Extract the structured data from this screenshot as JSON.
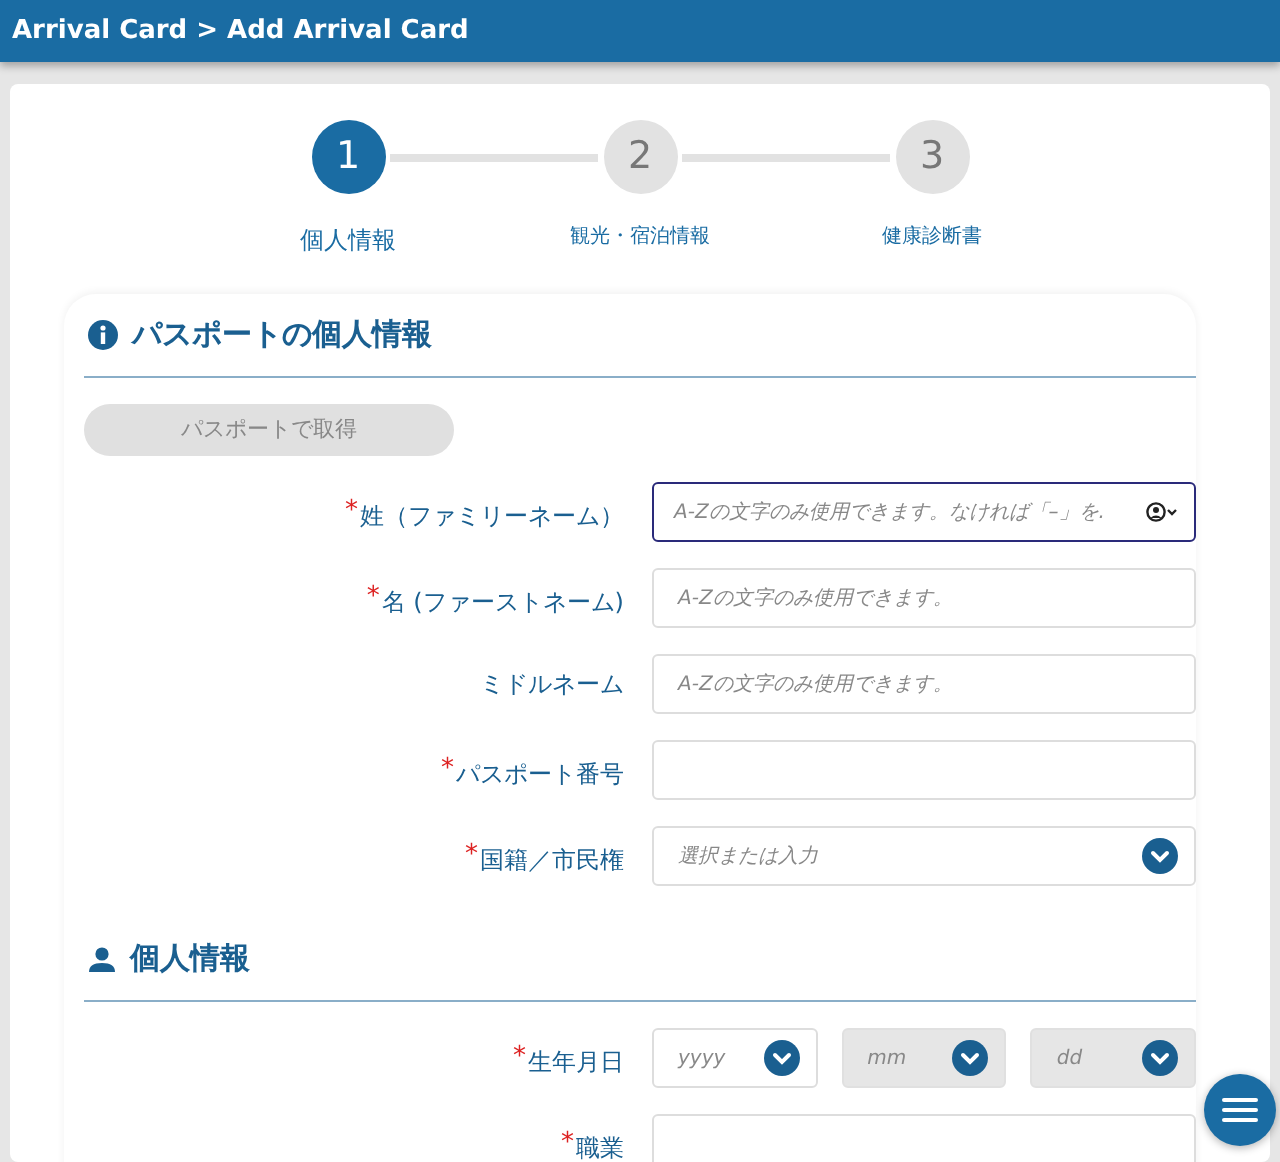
{
  "header": {
    "breadcrumb": "Arrival Card > Add Arrival Card"
  },
  "required_marker": "*",
  "steps": [
    {
      "number": "1",
      "label": "個人情報",
      "selected": true
    },
    {
      "number": "2",
      "label": "観光・宿泊情報",
      "selected": false
    },
    {
      "number": "3",
      "label": "健康診断書",
      "selected": false
    }
  ],
  "sections": [
    {
      "kind": "info",
      "title": "パスポートの個人情報",
      "button": {
        "label": "パスポートで取得",
        "disabled": true
      },
      "fields": [
        {
          "kind": "text",
          "label": "姓（ファミリーネーム）",
          "required": true,
          "placeholder": "A-Zの文字のみ使用できます。なければ「–」を.",
          "focused": true,
          "autofill": true
        },
        {
          "kind": "text",
          "label": "名 (ファーストネーム)",
          "required": true,
          "placeholder": "A-Zの文字のみ使用できます。",
          "focused": false,
          "autofill": false
        },
        {
          "kind": "text",
          "label": "ミドルネーム",
          "required": false,
          "placeholder": "A-Zの文字のみ使用できます。",
          "focused": false,
          "autofill": false
        },
        {
          "kind": "text",
          "label": "パスポート番号",
          "required": true,
          "focused": false,
          "autofill": false
        },
        {
          "kind": "select",
          "label": "国籍／市民権",
          "required": true,
          "placeholder": "選択または入力",
          "focused": false
        }
      ]
    },
    {
      "kind": "person",
      "title": "個人情報",
      "fields": [
        {
          "kind": "date",
          "label": "生年月日",
          "required": true,
          "parts": [
            {
              "placeholder": "yyyy",
              "disabled": false
            },
            {
              "placeholder": "mm",
              "disabled": true
            },
            {
              "placeholder": "dd",
              "disabled": true
            }
          ]
        },
        {
          "kind": "text",
          "label": "職業",
          "required": true,
          "focused": false,
          "autofill": false
        }
      ]
    }
  ]
}
